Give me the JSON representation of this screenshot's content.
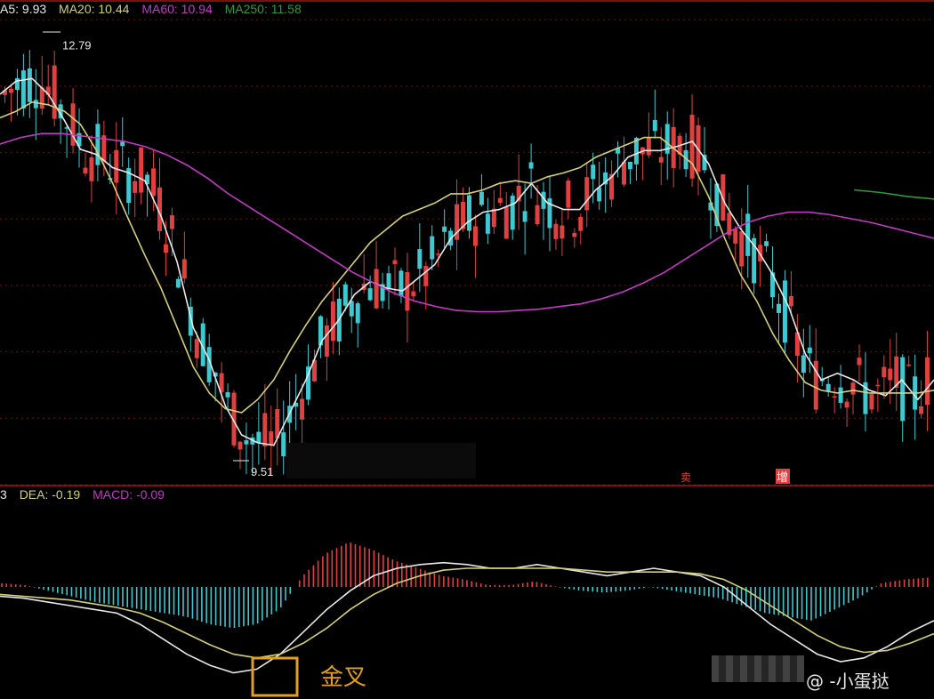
{
  "top_legend": [
    {
      "label": "A5: 9.93",
      "color": "#e8e8e8"
    },
    {
      "label": "MA20: 10.44",
      "color": "#d4cf7a"
    },
    {
      "label": "MA60: 10.94",
      "color": "#c03cc0"
    },
    {
      "label": "MA250: 11.58",
      "color": "#2f9a3a"
    }
  ],
  "macd_legend": [
    {
      "label": "3",
      "color": "#e8e8e8"
    },
    {
      "label": "DEA: -0.19",
      "color": "#d4cf7a"
    },
    {
      "label": "MACD: -0.09",
      "color": "#c03cc0"
    }
  ],
  "annotations": {
    "high_label": "12.79",
    "low_label": "9.51",
    "signal_a": "卖",
    "signal_b": "增",
    "golden_cross": "金叉",
    "watermark": "@ -小蛋挞"
  },
  "colors": {
    "up": "#e04040",
    "down": "#40c8d0",
    "ma5": "#e8e8e8",
    "ma20": "#d4cf7a",
    "ma60": "#c03cc0",
    "ma250": "#2f9a3a",
    "grid": "#6a1010",
    "highlight": "#e0a020"
  },
  "chart_data": [
    {
      "type": "candlestick",
      "title": "",
      "high": 12.79,
      "low": 9.51,
      "ma5_last": 9.93,
      "ma20_last": 10.44,
      "ma60_last": 10.94,
      "ma250_last": 11.58,
      "series": [
        {
          "name": "MA5",
          "values": [
            12.38,
            12.48,
            12.5,
            12.38,
            12.18,
            11.96,
            11.92,
            11.82,
            11.78,
            11.72,
            11.45,
            11.1,
            10.6,
            10.35,
            10.0,
            9.78,
            9.72,
            9.7,
            9.95,
            10.2,
            10.5,
            10.65,
            10.85,
            10.95,
            10.9,
            10.88,
            10.98,
            11.08,
            11.28,
            11.4,
            11.48,
            11.5,
            11.55,
            11.7,
            11.55,
            11.5,
            11.5,
            11.65,
            11.75,
            11.9,
            11.95,
            11.95,
            11.98,
            12.02,
            11.85,
            11.55,
            11.35,
            11.2,
            11.0,
            10.75,
            10.4,
            10.2,
            10.25,
            10.2,
            10.12,
            10.08,
            10.2,
            10.05,
            10.2
          ]
        },
        {
          "name": "MA20",
          "values": [
            12.2,
            12.25,
            12.32,
            12.3,
            12.25,
            12.15,
            11.95,
            11.7,
            11.42,
            11.15,
            10.9,
            10.6,
            10.3,
            10.1,
            9.98,
            9.95,
            10.05,
            10.2,
            10.42,
            10.62,
            10.8,
            10.95,
            11.1,
            11.25,
            11.35,
            11.45,
            11.5,
            11.55,
            11.62,
            11.62,
            11.65,
            11.7,
            11.72,
            11.7,
            11.75,
            11.78,
            11.82,
            11.9,
            11.95,
            12.0,
            12.05,
            12.05,
            11.95,
            11.85,
            11.6,
            11.28,
            11.0,
            10.8,
            10.55,
            10.35,
            10.18,
            10.12,
            10.1,
            10.12,
            10.1,
            10.1,
            10.1,
            10.1,
            10.12
          ]
        },
        {
          "name": "MA60",
          "values": [
            12.0,
            12.05,
            12.08,
            12.08,
            12.06,
            12.04,
            12.02,
            11.98,
            11.92,
            11.84,
            11.74,
            11.62,
            11.52,
            11.42,
            11.32,
            11.22,
            11.12,
            11.02,
            10.94,
            10.86,
            10.8,
            10.76,
            10.73,
            10.72,
            10.72,
            10.73,
            10.74,
            10.76,
            10.78,
            10.82,
            10.87,
            10.94,
            11.02,
            11.12,
            11.22,
            11.32,
            11.4,
            11.45,
            11.48,
            11.48,
            11.46,
            11.43,
            11.4,
            11.36,
            11.32,
            11.28
          ]
        },
        {
          "name": "MA250",
          "values": [
            11.65,
            11.63,
            11.6,
            11.58
          ]
        }
      ],
      "y_range": [
        9.4,
        12.95
      ]
    },
    {
      "type": "bar",
      "title": "MACD",
      "series": [
        {
          "name": "DIF",
          "values": [
            -0.05,
            -0.06,
            -0.08,
            -0.1,
            -0.12,
            -0.14,
            -0.2,
            -0.28,
            -0.36,
            -0.42,
            -0.46,
            -0.44,
            -0.36,
            -0.24,
            -0.12,
            -0.02,
            0.06,
            0.1,
            0.12,
            0.13,
            0.12,
            0.1,
            0.1,
            0.12,
            0.1,
            0.08,
            0.06,
            0.08,
            0.1,
            0.08,
            0.06,
            0.0,
            -0.1,
            -0.2,
            -0.28,
            -0.36,
            -0.4,
            -0.38,
            -0.32,
            -0.24,
            -0.18
          ]
        },
        {
          "name": "DEA",
          "values": [
            -0.04,
            -0.05,
            -0.06,
            -0.07,
            -0.09,
            -0.11,
            -0.14,
            -0.19,
            -0.25,
            -0.31,
            -0.36,
            -0.38,
            -0.36,
            -0.3,
            -0.22,
            -0.12,
            -0.04,
            0.02,
            0.06,
            0.09,
            0.1,
            0.1,
            0.1,
            0.1,
            0.1,
            0.09,
            0.08,
            0.08,
            0.08,
            0.08,
            0.07,
            0.04,
            -0.02,
            -0.1,
            -0.18,
            -0.26,
            -0.32,
            -0.35,
            -0.34,
            -0.3,
            -0.25
          ]
        },
        {
          "name": "MACD",
          "values": [
            0.02,
            0.01,
            -0.02,
            -0.05,
            -0.08,
            -0.1,
            -0.12,
            -0.14,
            -0.16,
            -0.2,
            -0.22,
            -0.2,
            -0.12,
            0.06,
            0.18,
            0.24,
            0.2,
            0.14,
            0.1,
            0.06,
            0.04,
            0.01,
            0.01,
            0.03,
            0.0,
            -0.02,
            -0.03,
            -0.02,
            0.0,
            -0.02,
            -0.04,
            -0.06,
            -0.1,
            -0.14,
            -0.16,
            -0.18,
            -0.12,
            -0.06,
            0.02,
            0.04,
            0.05
          ]
        }
      ]
    }
  ]
}
